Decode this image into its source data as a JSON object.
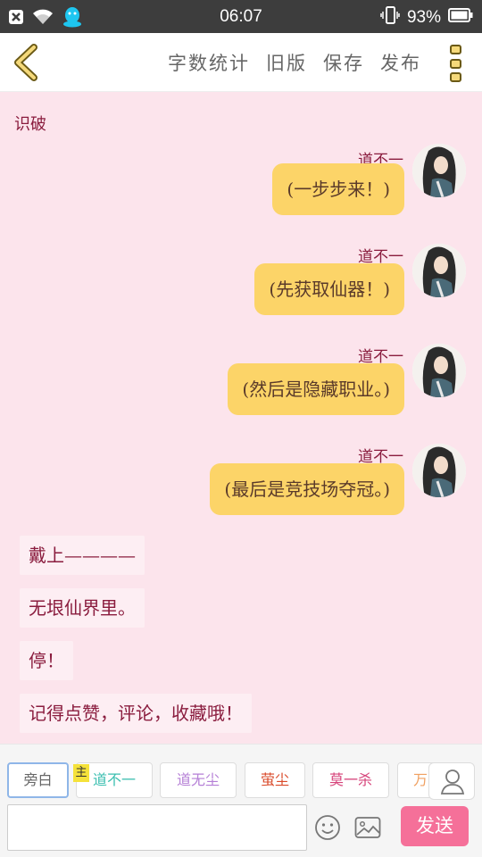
{
  "status_bar": {
    "time": "06:07",
    "battery": "93%"
  },
  "header": {
    "actions": [
      "字数统计",
      "旧版",
      "保存",
      "发布"
    ]
  },
  "chat": {
    "title": "识破",
    "messages": [
      {
        "name": "道不一",
        "text": "(一步步来！)"
      },
      {
        "name": "道不一",
        "text": "(先获取仙器！)"
      },
      {
        "name": "道不一",
        "text": "(然后是隐藏职业。)"
      },
      {
        "name": "道不一",
        "text": "(最后是竞技场夺冠。)"
      }
    ],
    "narrations": [
      "戴上————",
      "无垠仙界里。",
      "停！",
      "记得点赞，评论，收藏哦！"
    ]
  },
  "bottom": {
    "roles": [
      {
        "label": "旁白",
        "color": "#666666"
      },
      {
        "label": "道不一",
        "color": "#3bbfb0"
      },
      {
        "label": "道无尘",
        "color": "#b57fd6"
      },
      {
        "label": "萤尘",
        "color": "#d94a2a"
      },
      {
        "label": "莫一杀",
        "color": "#d6437a"
      },
      {
        "label": "万",
        "color": "#f0a060"
      }
    ],
    "main_badge": "主",
    "input_value": "",
    "send_label": "发送"
  }
}
